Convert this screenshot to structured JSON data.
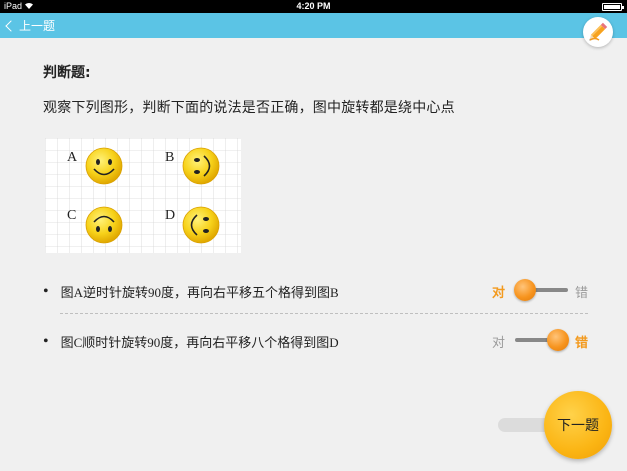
{
  "status_bar": {
    "device": "iPad",
    "time": "4:20 PM"
  },
  "nav": {
    "back_label": "上一题"
  },
  "question": {
    "type_label": "判断题:",
    "prompt": "观察下列图形，判断下面的说法是否正确，图中旋转都是绕中心点",
    "figure_labels": [
      "A",
      "B",
      "C",
      "D"
    ]
  },
  "statements": [
    {
      "text": "图A逆时针旋转90度，再向右平移五个格得到图B",
      "true_label": "对",
      "false_label": "错",
      "selected": "对"
    },
    {
      "text": "图C顺时针旋转90度，再向右平移八个格得到图D",
      "true_label": "对",
      "false_label": "错",
      "selected": "错"
    }
  ],
  "footer": {
    "next_label": "下一题"
  },
  "colors": {
    "nav": "#5bc4e5",
    "accent": "#f39a1e",
    "next_button": "#fbb514",
    "smiley": "#f7d21a"
  },
  "icons": {
    "back": "chevron-left-icon",
    "pencil": "pencil-icon",
    "wifi": "wifi-icon",
    "battery": "battery-icon"
  }
}
